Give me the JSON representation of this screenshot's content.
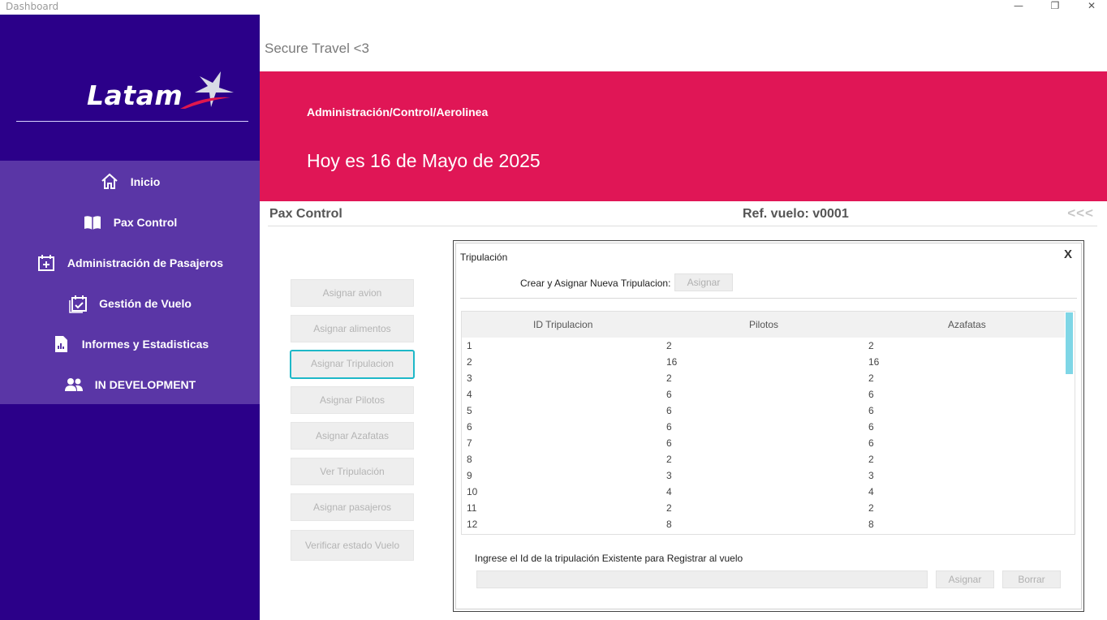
{
  "window": {
    "title": "Dashboard",
    "minimize": "—",
    "restore": "❐",
    "close": "✕"
  },
  "brand": {
    "logo_text": "Latam",
    "app_title": "Secure Travel <3"
  },
  "sidebar": {
    "items": [
      {
        "label": "Inicio",
        "icon": "home-icon"
      },
      {
        "label": "Pax Control",
        "icon": "book-icon"
      },
      {
        "label": "Administración de Pasajeros",
        "icon": "calendar-plus-icon"
      },
      {
        "label": "Gestión de Vuelo",
        "icon": "calendar-check-icon"
      },
      {
        "label": "Informes y Estadisticas",
        "icon": "report-icon"
      },
      {
        "label": "IN DEVELOPMENT",
        "icon": "people-icon"
      }
    ]
  },
  "banner": {
    "path": "Administración/Control/Aerolinea",
    "date": "Hoy es 16 de Mayo de 2025"
  },
  "subheader": {
    "section": "Pax Control",
    "flight_ref": "Ref. vuelo: v0001",
    "back": "<<<"
  },
  "actions": [
    "Asignar avion",
    "Asignar alimentos",
    "Asignar Tripulacion",
    "Asignar Pilotos",
    "Asignar Azafatas",
    "Ver Tripulación",
    "Asignar pasajeros",
    "Verificar estado Vuelo"
  ],
  "panel": {
    "title": "Tripulación",
    "close": "X",
    "create_label": "Crear y Asignar Nueva Tripulacion:",
    "create_button": "Asignar",
    "table": {
      "columns": [
        "ID Tripulacion",
        "Pilotos",
        "Azafatas"
      ],
      "rows": [
        [
          "1",
          "2",
          "2"
        ],
        [
          "2",
          "16",
          "16"
        ],
        [
          "3",
          "2",
          "2"
        ],
        [
          "4",
          "6",
          "6"
        ],
        [
          "5",
          "6",
          "6"
        ],
        [
          "6",
          "6",
          "6"
        ],
        [
          "7",
          "6",
          "6"
        ],
        [
          "8",
          "2",
          "2"
        ],
        [
          "9",
          "3",
          "3"
        ],
        [
          "10",
          "4",
          "4"
        ],
        [
          "11",
          "2",
          "2"
        ],
        [
          "12",
          "8",
          "8"
        ]
      ]
    },
    "existing_label": "Ingrese el Id de la tripulación Existente para Registrar al vuelo",
    "existing_value": "",
    "assign_button": "Asignar",
    "clear_button": "Borrar"
  },
  "colors": {
    "sidebar": "#2b0089",
    "menu": "#5a36a6",
    "banner": "#e01656",
    "focus": "#1eb8c8"
  }
}
